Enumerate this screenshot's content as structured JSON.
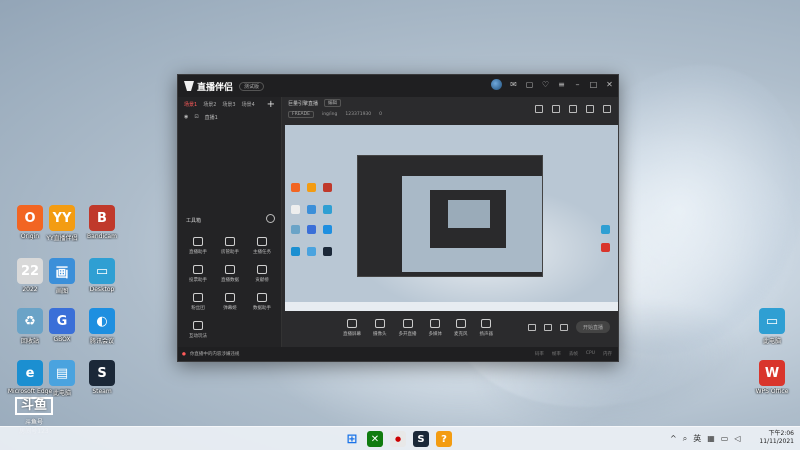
{
  "desktop": {
    "icons_left": [
      {
        "label": "Origin",
        "color": "#f26522",
        "glyph": "O"
      },
      {
        "label": "YY直播伴侣",
        "color": "#f39c12",
        "glyph": "YY"
      },
      {
        "label": "Bandicam",
        "color": "#c0392b",
        "glyph": "B"
      },
      {
        "label": "2022",
        "color": "#d9d9d9",
        "glyph": "22"
      },
      {
        "label": "画图",
        "color": "#3b8fd9",
        "glyph": "画"
      },
      {
        "label": "Desktop",
        "color": "#2f9fd3",
        "glyph": "▭"
      },
      {
        "label": "回收站",
        "color": "#6aa3c7",
        "glyph": "♻"
      },
      {
        "label": "GBOX",
        "color": "#3a6fd8",
        "glyph": "G"
      },
      {
        "label": "腾讯会议",
        "color": "#1e8fe0",
        "glyph": "◐"
      },
      {
        "label": "Microsoft Edge",
        "color": "#1b8fd1",
        "glyph": "e"
      },
      {
        "label": "此电脑",
        "color": "#4aa3df",
        "glyph": "▤"
      },
      {
        "label": "Steam",
        "color": "#1b2838",
        "glyph": "S"
      }
    ],
    "icons_right": [
      {
        "label": "此电脑",
        "color": "#2f9fd3",
        "glyph": "▭"
      },
      {
        "label": "WPS Office",
        "color": "#d9352c",
        "glyph": "W"
      }
    ]
  },
  "app": {
    "title": "直播伴侣",
    "version_badge": "测试版",
    "scene_tabs": [
      "场景1",
      "场景2",
      "场景3",
      "场景4"
    ],
    "scene_item": "直播1",
    "toolbox_title": "工具箱",
    "tools": [
      "直播助手",
      "房管助手",
      "主播任务",
      "投票助手",
      "直播数据",
      "贡献榜",
      "粉丝团",
      "弹幕姬",
      "数据助手",
      "互动玩法"
    ],
    "main_title": "巨量引擎直播",
    "main_pill": "编辑",
    "main_sub": [
      "FREADE",
      "ing/ing",
      "123371930",
      "0"
    ],
    "bottom_tools": [
      "直播屏幕",
      "摄像头",
      "多开直播",
      "多媒体",
      "麦克风",
      "扬声器"
    ],
    "live_button": "开始直播",
    "status_warning": "你直播中的内容涉嫌违规",
    "status_stats": [
      "码率",
      "帧率",
      "丢帧",
      "CPU",
      "内存"
    ]
  },
  "taskbar": {
    "clock_time": "下午2:06",
    "clock_date": "11/11/2021",
    "tray_lang": "英"
  },
  "watermark": {
    "mark": "斗鱼",
    "name": "斗鱼号",
    "id": "房间号123"
  },
  "colors": {
    "accent": "#ff5a5a",
    "window_bg": "#2b2b2d"
  }
}
